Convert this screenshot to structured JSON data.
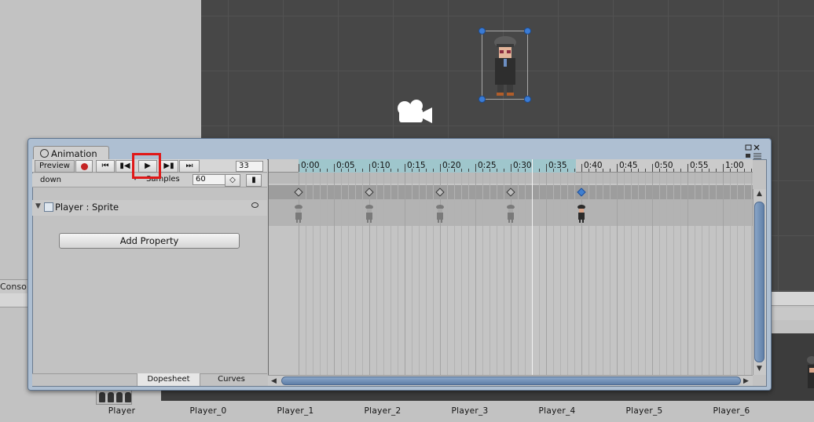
{
  "window": {
    "tab_title": "Animation"
  },
  "toolbar": {
    "preview_label": "Preview",
    "record_icon": "record-icon",
    "first_key_icon": "first-key-icon",
    "prev_key_icon": "prev-key-icon",
    "play_icon": "play-icon",
    "next_key_icon": "next-key-icon",
    "last_key_icon": "last-key-icon",
    "frame_value": "33"
  },
  "clip": {
    "selected_clip": "down",
    "samples_label": "Samples",
    "samples_value": "60"
  },
  "properties": {
    "items": [
      {
        "label": "Player : Sprite"
      }
    ],
    "add_property_label": "Add Property"
  },
  "bottom_tabs": [
    {
      "label": "Dopesheet"
    },
    {
      "label": "Curves"
    }
  ],
  "timeline": {
    "tick_labels": [
      "0:00",
      "0:05",
      "0:10",
      "0:15",
      "0:20",
      "0:25",
      "0:30",
      "0:35",
      "0:40",
      "0:45",
      "0:50",
      "0:55",
      "1:00"
    ],
    "keyframes": [
      "0:00",
      "0:10",
      "0:20",
      "0:30",
      "0:40"
    ],
    "selected_keyframe": "0:40",
    "playhead_time": "0:33"
  },
  "assets": {
    "labels": [
      "Player",
      "Player_0",
      "Player_1",
      "Player_2",
      "Player_3",
      "Player_4",
      "Player_5",
      "Player_6"
    ]
  },
  "console_tab": "Conso",
  "colors": {
    "highlight": "#e01818",
    "selection": "#3a7bd5",
    "ruler_range": "#9fc6cc"
  }
}
